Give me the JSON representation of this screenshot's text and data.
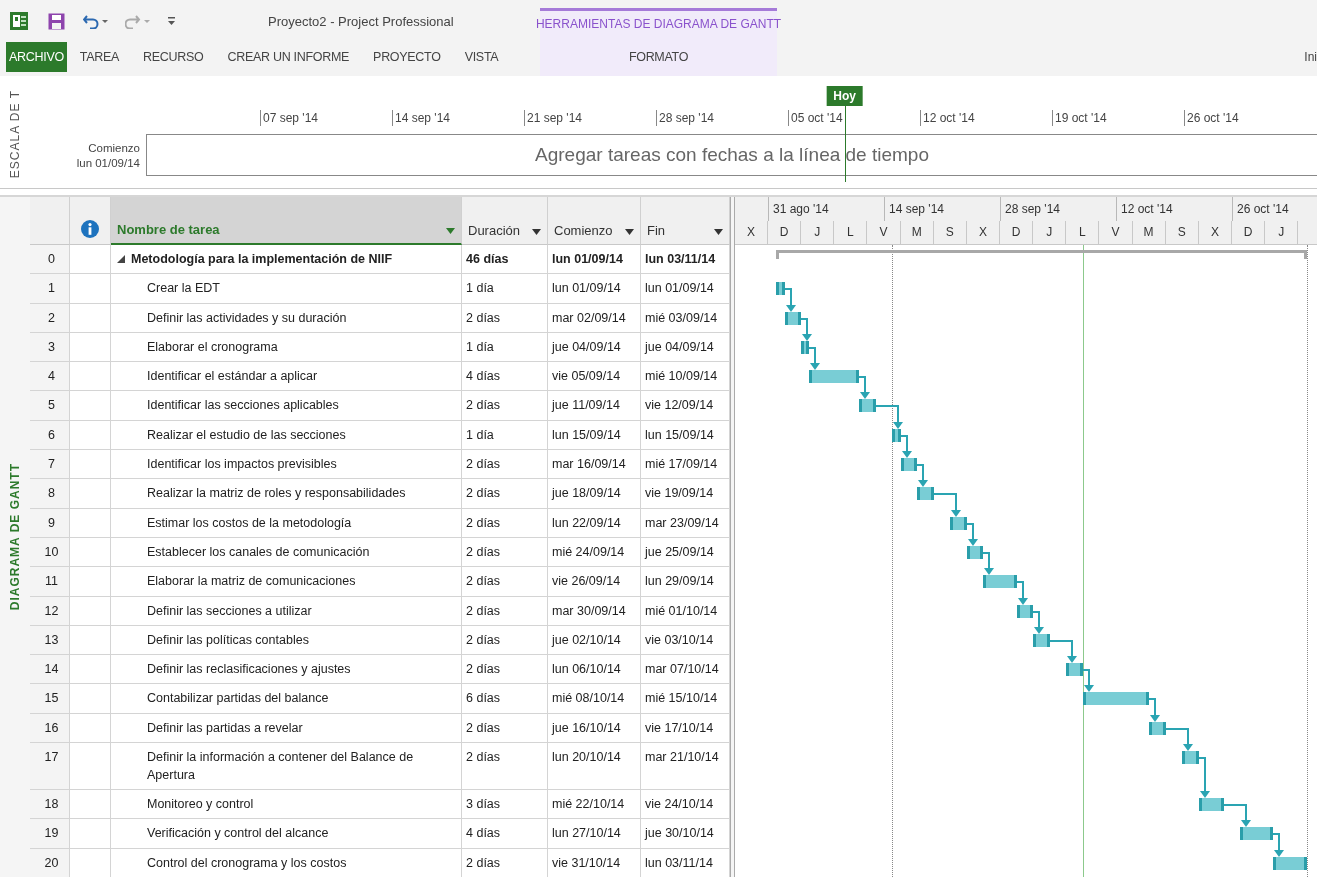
{
  "window": {
    "title": "Proyecto2 - Project Professional"
  },
  "contextual_group": {
    "label": "HERRAMIENTAS DE DIAGRAMA DE GANTT"
  },
  "ribbon_tabs": [
    {
      "label": "ARCHIVO",
      "kind": "file"
    },
    {
      "label": "TAREA",
      "kind": "normal"
    },
    {
      "label": "RECURSO",
      "kind": "normal"
    },
    {
      "label": "CREAR UN INFORME",
      "kind": "normal"
    },
    {
      "label": "PROYECTO",
      "kind": "normal"
    },
    {
      "label": "VISTA",
      "kind": "normal"
    },
    {
      "label": "FORMATO",
      "kind": "contextual"
    }
  ],
  "account": {
    "label": "Ini"
  },
  "timeline": {
    "side_label": "ESCALA DE T",
    "today_label": "Hoy",
    "start_label": "Comienzo",
    "start_date": "lun 01/09/14",
    "message": "Agregar tareas con fechas a la línea de tiempo",
    "ticks": [
      "07 sep '14",
      "14 sep '14",
      "21 sep '14",
      "28 sep '14",
      "05 oct '14",
      "12 oct '14",
      "19 oct '14",
      "26 oct '14"
    ]
  },
  "view_label": "DIAGRAMA DE GANTT",
  "table": {
    "columns": [
      {
        "kind": "info"
      },
      {
        "kind": "text",
        "label": "Nombre de tarea",
        "selected": true
      },
      {
        "kind": "text",
        "label": "Duración",
        "selected": false
      },
      {
        "kind": "text",
        "label": "Comienzo",
        "selected": false
      },
      {
        "kind": "text",
        "label": "Fin",
        "selected": false
      }
    ],
    "rows": [
      {
        "id": "0",
        "kind": "summary",
        "expanded": true,
        "name": "Metodología para la implementación de NIIF",
        "duration": "46 días",
        "start": "lun 01/09/14",
        "finish": "lun 03/11/14"
      },
      {
        "id": "1",
        "kind": "task",
        "name": "Crear la EDT",
        "duration": "1 día",
        "start": "lun 01/09/14",
        "finish": "lun 01/09/14"
      },
      {
        "id": "2",
        "kind": "task",
        "name": "Definir las actividades y su duración",
        "duration": "2 días",
        "start": "mar 02/09/14",
        "finish": "mié 03/09/14"
      },
      {
        "id": "3",
        "kind": "task",
        "name": "Elaborar el cronograma",
        "duration": "1 día",
        "start": "jue 04/09/14",
        "finish": "jue 04/09/14"
      },
      {
        "id": "4",
        "kind": "task",
        "name": "Identificar el estándar a aplicar",
        "duration": "4 días",
        "start": "vie 05/09/14",
        "finish": "mié 10/09/14"
      },
      {
        "id": "5",
        "kind": "task",
        "name": "Identificar las secciones aplicables",
        "duration": "2 días",
        "start": "jue 11/09/14",
        "finish": "vie 12/09/14"
      },
      {
        "id": "6",
        "kind": "task",
        "name": "Realizar el estudio de las secciones",
        "duration": "1 día",
        "start": "lun 15/09/14",
        "finish": "lun 15/09/14"
      },
      {
        "id": "7",
        "kind": "task",
        "name": "Identificar los impactos previsibles",
        "duration": "2 días",
        "start": "mar 16/09/14",
        "finish": "mié 17/09/14"
      },
      {
        "id": "8",
        "kind": "task",
        "name": "Realizar la matriz de roles y responsabilidades",
        "duration": "2 días",
        "start": "jue 18/09/14",
        "finish": "vie 19/09/14"
      },
      {
        "id": "9",
        "kind": "task",
        "name": "Estimar los costos de la metodología",
        "duration": "2 días",
        "start": "lun 22/09/14",
        "finish": "mar 23/09/14"
      },
      {
        "id": "10",
        "kind": "task",
        "name": "Establecer los canales de comunicación",
        "duration": "2 días",
        "start": "mié 24/09/14",
        "finish": "jue 25/09/14"
      },
      {
        "id": "11",
        "kind": "task",
        "name": "Elaborar la matriz de comunicaciones",
        "duration": "2 días",
        "start": "vie 26/09/14",
        "finish": "lun 29/09/14"
      },
      {
        "id": "12",
        "kind": "task",
        "name": "Definir las secciones a utilizar",
        "duration": "2 días",
        "start": "mar 30/09/14",
        "finish": "mié 01/10/14"
      },
      {
        "id": "13",
        "kind": "task",
        "name": "Definir las políticas contables",
        "duration": "2 días",
        "start": "jue 02/10/14",
        "finish": "vie 03/10/14"
      },
      {
        "id": "14",
        "kind": "task",
        "name": "Definir las reclasificaciones y ajustes",
        "duration": "2 días",
        "start": "lun 06/10/14",
        "finish": "mar 07/10/14"
      },
      {
        "id": "15",
        "kind": "task",
        "name": "Contabilizar partidas del balance",
        "duration": "6 días",
        "start": "mié 08/10/14",
        "finish": "mié 15/10/14"
      },
      {
        "id": "16",
        "kind": "task",
        "name": "Definir las partidas a revelar",
        "duration": "2 días",
        "start": "jue 16/10/14",
        "finish": "vie 17/10/14"
      },
      {
        "id": "17",
        "kind": "task",
        "name": "Definir la información a contener del Balance de Apertura",
        "duration": "2 días",
        "start": "lun 20/10/14",
        "finish": "mar 21/10/14"
      },
      {
        "id": "18",
        "kind": "task",
        "name": "Monitoreo y control",
        "duration": "3 días",
        "start": "mié 22/10/14",
        "finish": "vie 24/10/14"
      },
      {
        "id": "19",
        "kind": "task",
        "name": "Verificación y control del alcance",
        "duration": "4 días",
        "start": "lun 27/10/14",
        "finish": "jue 30/10/14"
      },
      {
        "id": "20",
        "kind": "task",
        "name": "Control del cronograma y los costos",
        "duration": "2 días",
        "start": "vie 31/10/14",
        "finish": "lun 03/11/14"
      }
    ]
  },
  "gantt": {
    "major": [
      "31 ago '14",
      "14 sep '14",
      "28 sep '14",
      "12 oct '14",
      "26 oct '14"
    ],
    "minor": [
      "X",
      "D",
      "J",
      "L",
      "V",
      "M",
      "S",
      "X",
      "D",
      "J",
      "L",
      "V",
      "M",
      "S",
      "X",
      "D",
      "J"
    ]
  }
}
